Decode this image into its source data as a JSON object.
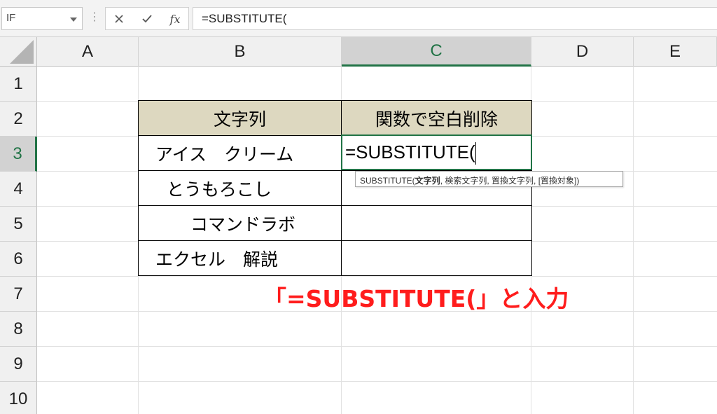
{
  "formula_bar": {
    "name_box": "IF",
    "cancel_icon": "close-icon",
    "enter_icon": "check-icon",
    "fx_label": "fx",
    "formula": "=SUBSTITUTE("
  },
  "columns": [
    "A",
    "B",
    "C",
    "D",
    "E"
  ],
  "active_column": "C",
  "rows": [
    "1",
    "2",
    "3",
    "4",
    "5",
    "6",
    "7",
    "8",
    "9",
    "10"
  ],
  "active_row": "3",
  "table": {
    "headers": [
      "文字列",
      "関数で空白削除"
    ],
    "rows": [
      "アイス　クリーム",
      "  とうもろこし",
      "　　コマンドラボ",
      "エクセル　解説"
    ]
  },
  "active_cell": {
    "value": "=SUBSTITUTE("
  },
  "tooltip": {
    "func": "SUBSTITUTE(",
    "arg1": "文字列",
    "rest": ", 検索文字列, 置換文字列, [置換対象])"
  },
  "annotation": "「=SUBSTITUTE(」と入力",
  "colors": {
    "accent": "#217346",
    "header_fill": "#ddd8c0",
    "annotation": "#ff1c1c"
  }
}
